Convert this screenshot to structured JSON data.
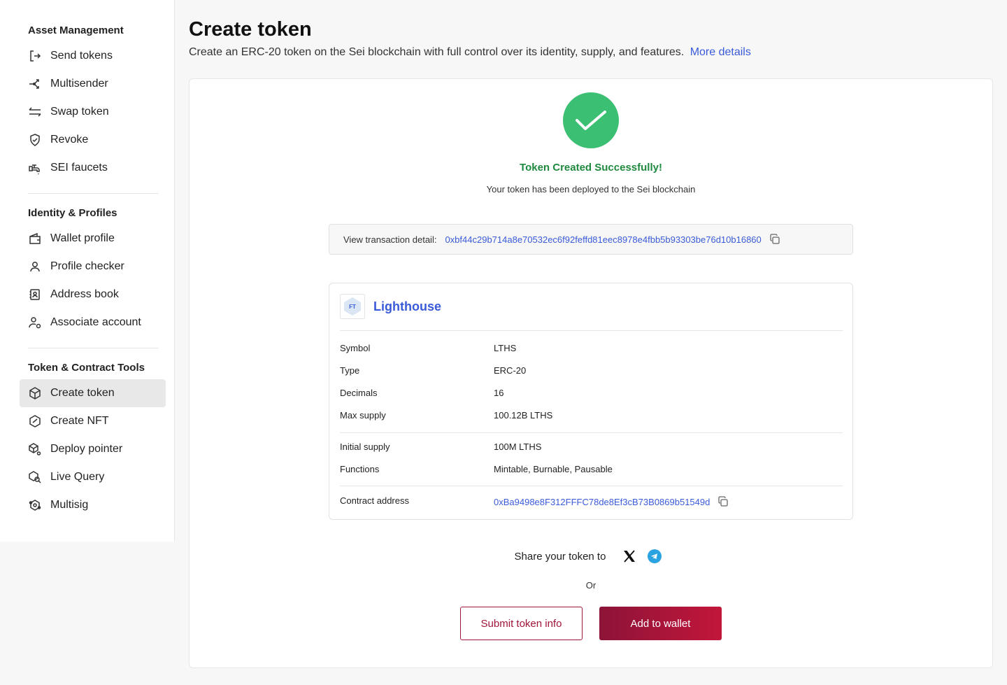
{
  "sidebar": {
    "sections": [
      {
        "title": "Asset Management",
        "items": [
          {
            "label": "Send tokens",
            "icon": "send-icon"
          },
          {
            "label": "Multisender",
            "icon": "multisender-icon"
          },
          {
            "label": "Swap token",
            "icon": "swap-icon"
          },
          {
            "label": "Revoke",
            "icon": "shield-icon"
          },
          {
            "label": "SEI faucets",
            "icon": "faucet-icon"
          }
        ]
      },
      {
        "title": "Identity & Profiles",
        "items": [
          {
            "label": "Wallet profile",
            "icon": "wallet-icon"
          },
          {
            "label": "Profile checker",
            "icon": "user-icon"
          },
          {
            "label": "Address book",
            "icon": "address-book-icon"
          },
          {
            "label": "Associate account",
            "icon": "associate-icon"
          }
        ]
      },
      {
        "title": "Token & Contract Tools",
        "items": [
          {
            "label": "Create token",
            "icon": "cube-icon",
            "active": true
          },
          {
            "label": "Create NFT",
            "icon": "nft-icon"
          },
          {
            "label": "Deploy pointer",
            "icon": "deploy-icon"
          },
          {
            "label": "Live Query",
            "icon": "query-icon"
          },
          {
            "label": "Multisig",
            "icon": "multisig-icon"
          }
        ]
      }
    ]
  },
  "header": {
    "title": "Create token",
    "description": "Create an ERC-20 token on the Sei blockchain with full control over its identity, supply, and features.",
    "more_link": "More details"
  },
  "success": {
    "title": "Token Created Successfully!",
    "subtitle": "Your token has been deployed to the Sei blockchain"
  },
  "transaction": {
    "label": "View transaction detail:",
    "hash": "0xbf44c29b714a8e70532ec6f92feffd81eec8978e4fbb5b93303be76d10b16860"
  },
  "token": {
    "logo_text": "FT",
    "name": "Lighthouse",
    "details": {
      "symbol": {
        "label": "Symbol",
        "value": "LTHS"
      },
      "type": {
        "label": "Type",
        "value": "ERC-20"
      },
      "decimals": {
        "label": "Decimals",
        "value": "16"
      },
      "max_supply": {
        "label": "Max supply",
        "value": "100.12B LTHS"
      },
      "initial_supply": {
        "label": "Initial supply",
        "value": "100M LTHS"
      },
      "functions": {
        "label": "Functions",
        "value": "Mintable, Burnable, Pausable"
      },
      "contract_address": {
        "label": "Contract address",
        "value": "0xBa9498e8F312FFFC78de8Ef3cB73B0869b51549d"
      }
    }
  },
  "share": {
    "label": "Share your token to",
    "or": "Or"
  },
  "actions": {
    "submit_label": "Submit token info",
    "add_wallet_label": "Add to wallet"
  },
  "colors": {
    "accent": "#3a5bd9",
    "success": "#3bbf72",
    "brand": "#a0163a"
  }
}
